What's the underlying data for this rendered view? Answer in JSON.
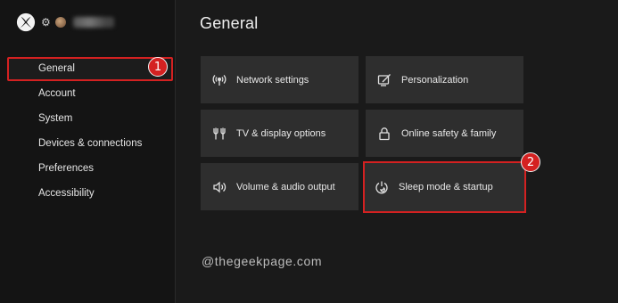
{
  "sidebar": {
    "items": [
      {
        "label": "General"
      },
      {
        "label": "Account"
      },
      {
        "label": "System"
      },
      {
        "label": "Devices & connections"
      },
      {
        "label": "Preferences"
      },
      {
        "label": "Accessibility"
      }
    ]
  },
  "main": {
    "title": "General",
    "tiles": [
      {
        "label": "Network settings",
        "icon": "network-icon"
      },
      {
        "label": "Personalization",
        "icon": "personalization-icon"
      },
      {
        "label": "TV & display options",
        "icon": "tv-display-icon"
      },
      {
        "label": "Online safety & family",
        "icon": "lock-icon"
      },
      {
        "label": "Volume & audio output",
        "icon": "speaker-icon"
      },
      {
        "label": "Sleep mode & startup",
        "icon": "power-icon"
      }
    ]
  },
  "annotations": {
    "badge1": "1",
    "badge2": "2"
  },
  "watermark": "@thegeekpage.com",
  "colors": {
    "highlight": "#d42121",
    "tile_bg": "#2e2e2e",
    "background": "#1a1a1a"
  }
}
